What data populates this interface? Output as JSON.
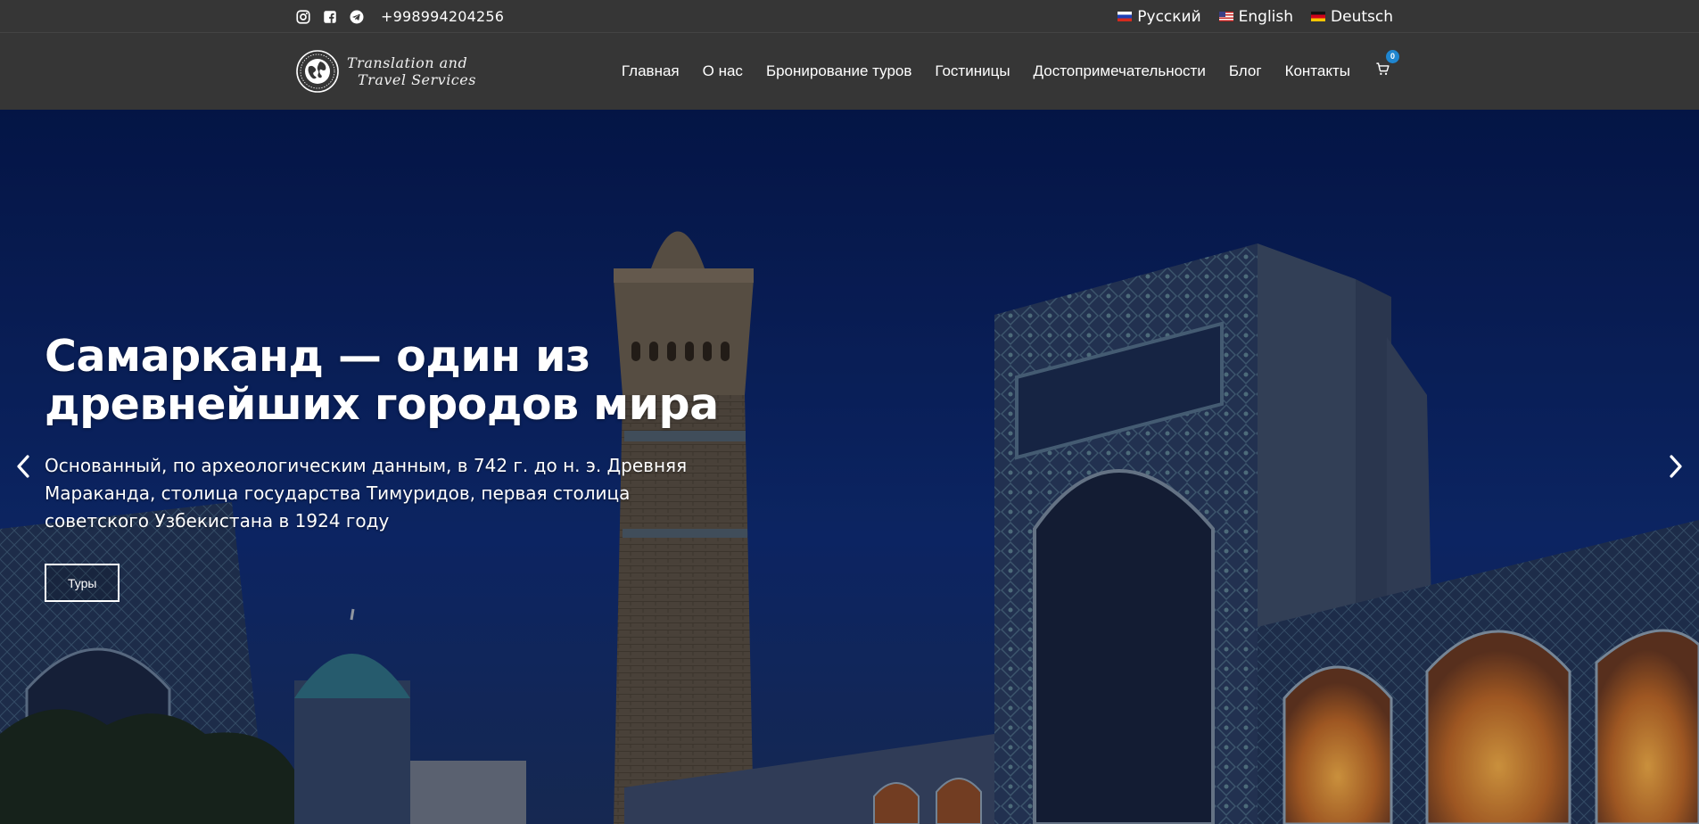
{
  "topbar": {
    "phone": "+998994204256",
    "social": [
      {
        "name": "instagram-icon"
      },
      {
        "name": "facebook-icon"
      },
      {
        "name": "telegram-icon"
      }
    ],
    "languages": [
      {
        "label": "Русский",
        "flag": "ru"
      },
      {
        "label": "English",
        "flag": "us"
      },
      {
        "label": "Deutsch",
        "flag": "de"
      }
    ]
  },
  "logo": {
    "line1": "Translation and",
    "line2": "Travel Services"
  },
  "nav": {
    "items": [
      {
        "label": "Главная"
      },
      {
        "label": "О нас"
      },
      {
        "label": "Бронирование туров"
      },
      {
        "label": "Гостиницы"
      },
      {
        "label": "Достопримечательности"
      },
      {
        "label": "Блог"
      },
      {
        "label": "Контакты"
      }
    ],
    "cart_count": "0"
  },
  "hero": {
    "title_line1": "Самарканд — один из",
    "title_line2": "древнейших городов мира",
    "text": "Основанный, по археологическим данным, в 742 г. до н. э. Древняя Мараканда, столица государства Тимуридов, первая столица советского Узбекистана в 1924 году",
    "button_label": "Туры"
  },
  "colors": {
    "bar_bg": "#363636",
    "cart_badge": "#1f86d0",
    "sky": "#0e2a6b"
  }
}
